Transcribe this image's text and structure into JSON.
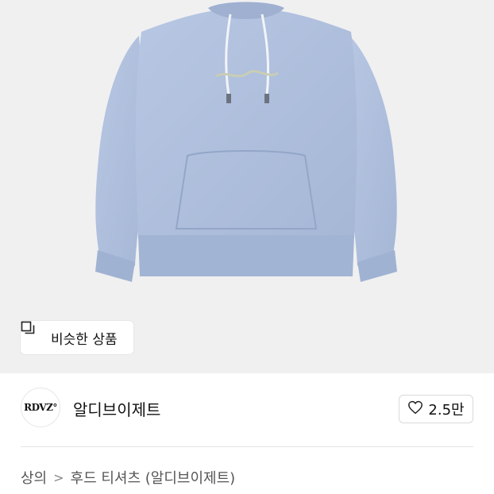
{
  "product": {
    "image_alt": "light blue hoodie",
    "hoodie_color": "#aebfdd",
    "similar_button_label": "비슷한 상품"
  },
  "brand": {
    "logo_text": "RDVZ°",
    "name": "알디브이제트",
    "like_count": "2.5만"
  },
  "breadcrumb": {
    "items": [
      "상의",
      "후드 티셔츠 (알디브이제트)"
    ],
    "separator": ">"
  }
}
